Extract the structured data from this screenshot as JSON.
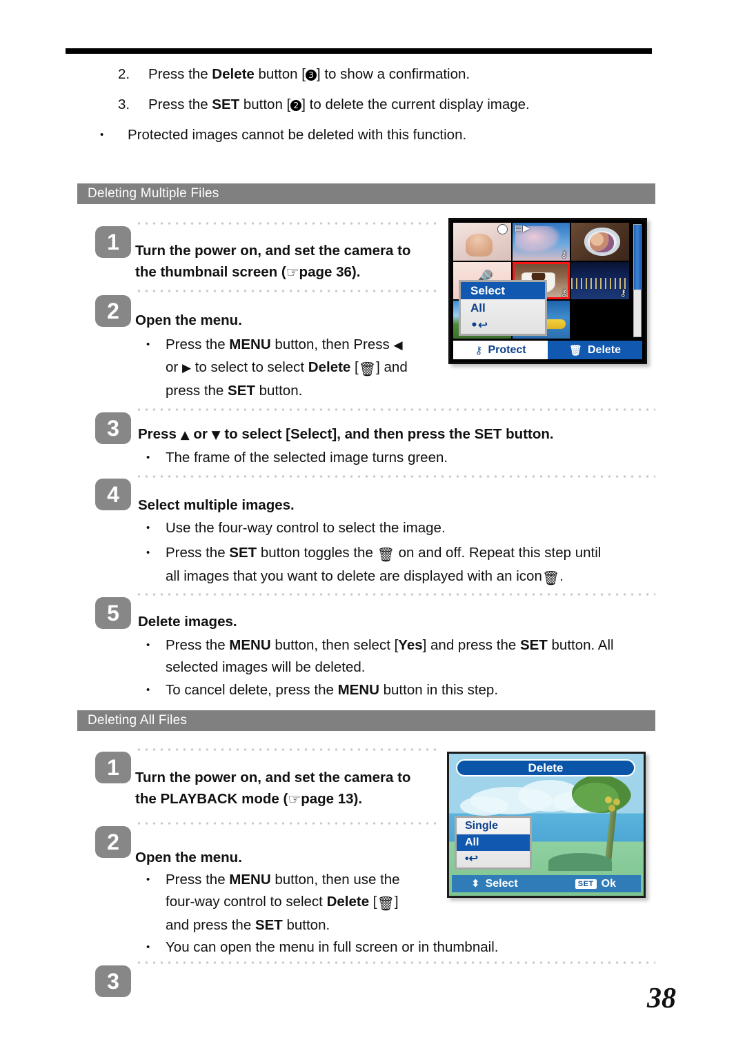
{
  "page": {
    "number": "38"
  },
  "intro": {
    "items": [
      {
        "num": "2.",
        "pre": "Press the ",
        "bold": "Delete",
        "mid": " button [",
        "marker": "3",
        "post": "] to show a confirmation."
      },
      {
        "num": "3.",
        "pre": "Press the ",
        "bold": "SET",
        "mid": " button [",
        "marker": "2",
        "post": "] to delete the current display image."
      }
    ],
    "note": "Protected images cannot be deleted with this function."
  },
  "sections": [
    {
      "title": "Deleting Multiple Files"
    },
    {
      "title": "Deleting All Files"
    }
  ],
  "multiple_steps": {
    "s1": {
      "badge": "1",
      "line1": "Turn the power on, and set the camera to",
      "line2_a": "the thumbnail screen (",
      "hand": "☞",
      "line2_b": "page 36)."
    },
    "s2": {
      "badge": "2",
      "title": "Open the menu.",
      "b1_a": "Press the ",
      "b1_menu": "MENU",
      "b1_b": " button, then Press ",
      "b1_left_arrow": "◀",
      "b2_a": "or ",
      "b2_right_arrow": "▶",
      "b2_b": " to select to select ",
      "b2_delete": "Delete",
      "b2_c": " [",
      "b2_trash": "🗑",
      "b2_d": "] and",
      "b3_a": "press the ",
      "b3_set": "SET",
      "b3_b": " button."
    },
    "s3": {
      "badge": "3",
      "title_a": "Press ",
      "up_arrow": "▲",
      "title_b": " or ",
      "down_arrow": "▼",
      "title_c": " to select [Select], and then press the SET button.",
      "b1": "The frame of the selected image turns green."
    },
    "s4": {
      "badge": "4",
      "title": "Select multiple images.",
      "b1": "Use the four-way control to select the image.",
      "b2_a": "Press the ",
      "b2_set": "SET",
      "b2_b": " button toggles the ",
      "b2_trash": "🗑",
      "b2_c": " on and off.   Repeat this step until",
      "b3_a": "all images that you want to delete are displayed with an icon",
      "b3_trash": "🗑",
      "b3_b": "."
    },
    "s5": {
      "badge": "5",
      "title": "Delete images.",
      "b1_a": "Press the ",
      "b1_menu": "MENU",
      "b1_b": " button, then select [",
      "b1_yes": "Yes",
      "b1_c": "] and press the ",
      "b1_set": "SET",
      "b1_d": " button.   All",
      "b1_e": "selected images will be deleted.",
      "b2_a": "To cancel delete, press the ",
      "b2_menu": "MENU",
      "b2_b": " button in this step."
    }
  },
  "all_steps": {
    "s1": {
      "badge": "1",
      "line1": "Turn the power on, and set the camera to",
      "line2_a": "the PLAYBACK mode (",
      "hand": "☞",
      "line2_b": "page 13)."
    },
    "s2": {
      "badge": "2",
      "title": "Open the menu.",
      "b1_a": "Press the ",
      "b1_menu": "MENU",
      "b1_b": " button, then use the",
      "b2_a": "four-way control to select ",
      "b2_delete": "Delete",
      "b2_b": " [",
      "b2_trash": "🗑",
      "b2_c": "]",
      "b3_a": "and press the ",
      "b3_set": "SET",
      "b3_b": " button.",
      "b4": "You can open the menu in full screen or in thumbnail."
    },
    "s3": {
      "badge": "3"
    }
  },
  "camera_thumbnail_screen": {
    "thumbnails": [
      {
        "name": "baby",
        "badge": "mic",
        "lock": ""
      },
      {
        "name": "cherry-blossom",
        "badge": "video",
        "lock": "⚷"
      },
      {
        "name": "porthole-girls",
        "badge": "",
        "lock": ""
      },
      {
        "name": "voice-memo",
        "badge": "",
        "lock": ""
      },
      {
        "name": "coffee-cup",
        "badge": "",
        "lock": "⚷",
        "selected": true
      },
      {
        "name": "night-city",
        "badge": "",
        "lock": "⚷"
      },
      {
        "name": "park",
        "badge": "",
        "lock": ""
      },
      {
        "name": "raft-boat",
        "badge": "",
        "lock": ""
      }
    ],
    "menu": {
      "items": [
        {
          "label": "Select",
          "selected": true
        },
        {
          "label": "All",
          "selected": false
        },
        {
          "label": "•↩",
          "selected": false
        }
      ]
    },
    "bottom_bar": {
      "protect_icon": "⚷",
      "protect_label": "Protect",
      "delete_icon": "🗑",
      "delete_label": "Delete"
    }
  },
  "camera_delete_screen": {
    "title": "Delete",
    "menu": {
      "items": [
        {
          "label": "Single",
          "selected": false
        },
        {
          "label": "All",
          "selected": true
        },
        {
          "label": "•↩",
          "selected": false
        }
      ]
    },
    "bottom_bar": {
      "updown_icon": "⬍",
      "select_label": "Select",
      "set_badge": "SET",
      "ok_label": "Ok"
    }
  },
  "colors": {
    "section_bar": "#808080",
    "step_badge": "#878787",
    "lcd_blue": "#1158b0",
    "lcd_title_blue": "#0a55a8",
    "selection_red": "#ff1414",
    "menu_text_blue": "#0b3f8c"
  }
}
